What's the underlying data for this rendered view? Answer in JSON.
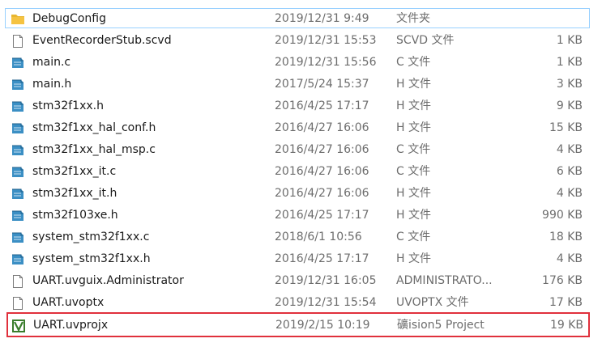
{
  "files": [
    {
      "name": "DebugConfig",
      "date": "2019/12/31 9:49",
      "type": "文件夹",
      "size": "",
      "icon": "folder-icon"
    },
    {
      "name": "EventRecorderStub.scvd",
      "date": "2019/12/31 15:53",
      "type": "SCVD 文件",
      "size": "1 KB",
      "icon": "blank-file-icon"
    },
    {
      "name": "main.c",
      "date": "2019/12/31 15:56",
      "type": "C 文件",
      "size": "1 KB",
      "icon": "source-file-icon"
    },
    {
      "name": "main.h",
      "date": "2017/5/24 15:37",
      "type": "H 文件",
      "size": "3 KB",
      "icon": "source-file-icon"
    },
    {
      "name": "stm32f1xx.h",
      "date": "2016/4/25 17:17",
      "type": "H 文件",
      "size": "9 KB",
      "icon": "source-file-icon"
    },
    {
      "name": "stm32f1xx_hal_conf.h",
      "date": "2016/4/27 16:06",
      "type": "H 文件",
      "size": "15 KB",
      "icon": "source-file-icon"
    },
    {
      "name": "stm32f1xx_hal_msp.c",
      "date": "2016/4/27 16:06",
      "type": "C 文件",
      "size": "4 KB",
      "icon": "source-file-icon"
    },
    {
      "name": "stm32f1xx_it.c",
      "date": "2016/4/27 16:06",
      "type": "C 文件",
      "size": "6 KB",
      "icon": "source-file-icon"
    },
    {
      "name": "stm32f1xx_it.h",
      "date": "2016/4/27 16:06",
      "type": "H 文件",
      "size": "4 KB",
      "icon": "source-file-icon"
    },
    {
      "name": "stm32f103xe.h",
      "date": "2016/4/25 17:17",
      "type": "H 文件",
      "size": "990 KB",
      "icon": "source-file-icon"
    },
    {
      "name": "system_stm32f1xx.c",
      "date": "2018/6/1 10:56",
      "type": "C 文件",
      "size": "18 KB",
      "icon": "source-file-icon"
    },
    {
      "name": "system_stm32f1xx.h",
      "date": "2016/4/25 17:17",
      "type": "H 文件",
      "size": "4 KB",
      "icon": "source-file-icon"
    },
    {
      "name": "UART.uvguix.Administrator",
      "date": "2019/12/31 16:05",
      "type": "ADMINISTRATO...",
      "size": "176 KB",
      "icon": "blank-file-icon"
    },
    {
      "name": "UART.uvoptx",
      "date": "2019/12/31 15:54",
      "type": "UVOPTX 文件",
      "size": "17 KB",
      "icon": "blank-file-icon"
    },
    {
      "name": "UART.uvprojx",
      "date": "2019/2/15 10:19",
      "type": "礦ision5 Project",
      "size": "19 KB",
      "icon": "keil-project-icon"
    }
  ],
  "colors": {
    "highlight_border": "#e0303c",
    "selected_border": "#99d1ff",
    "folder": "#f5c342",
    "keil_green": "#3a7d2c"
  }
}
